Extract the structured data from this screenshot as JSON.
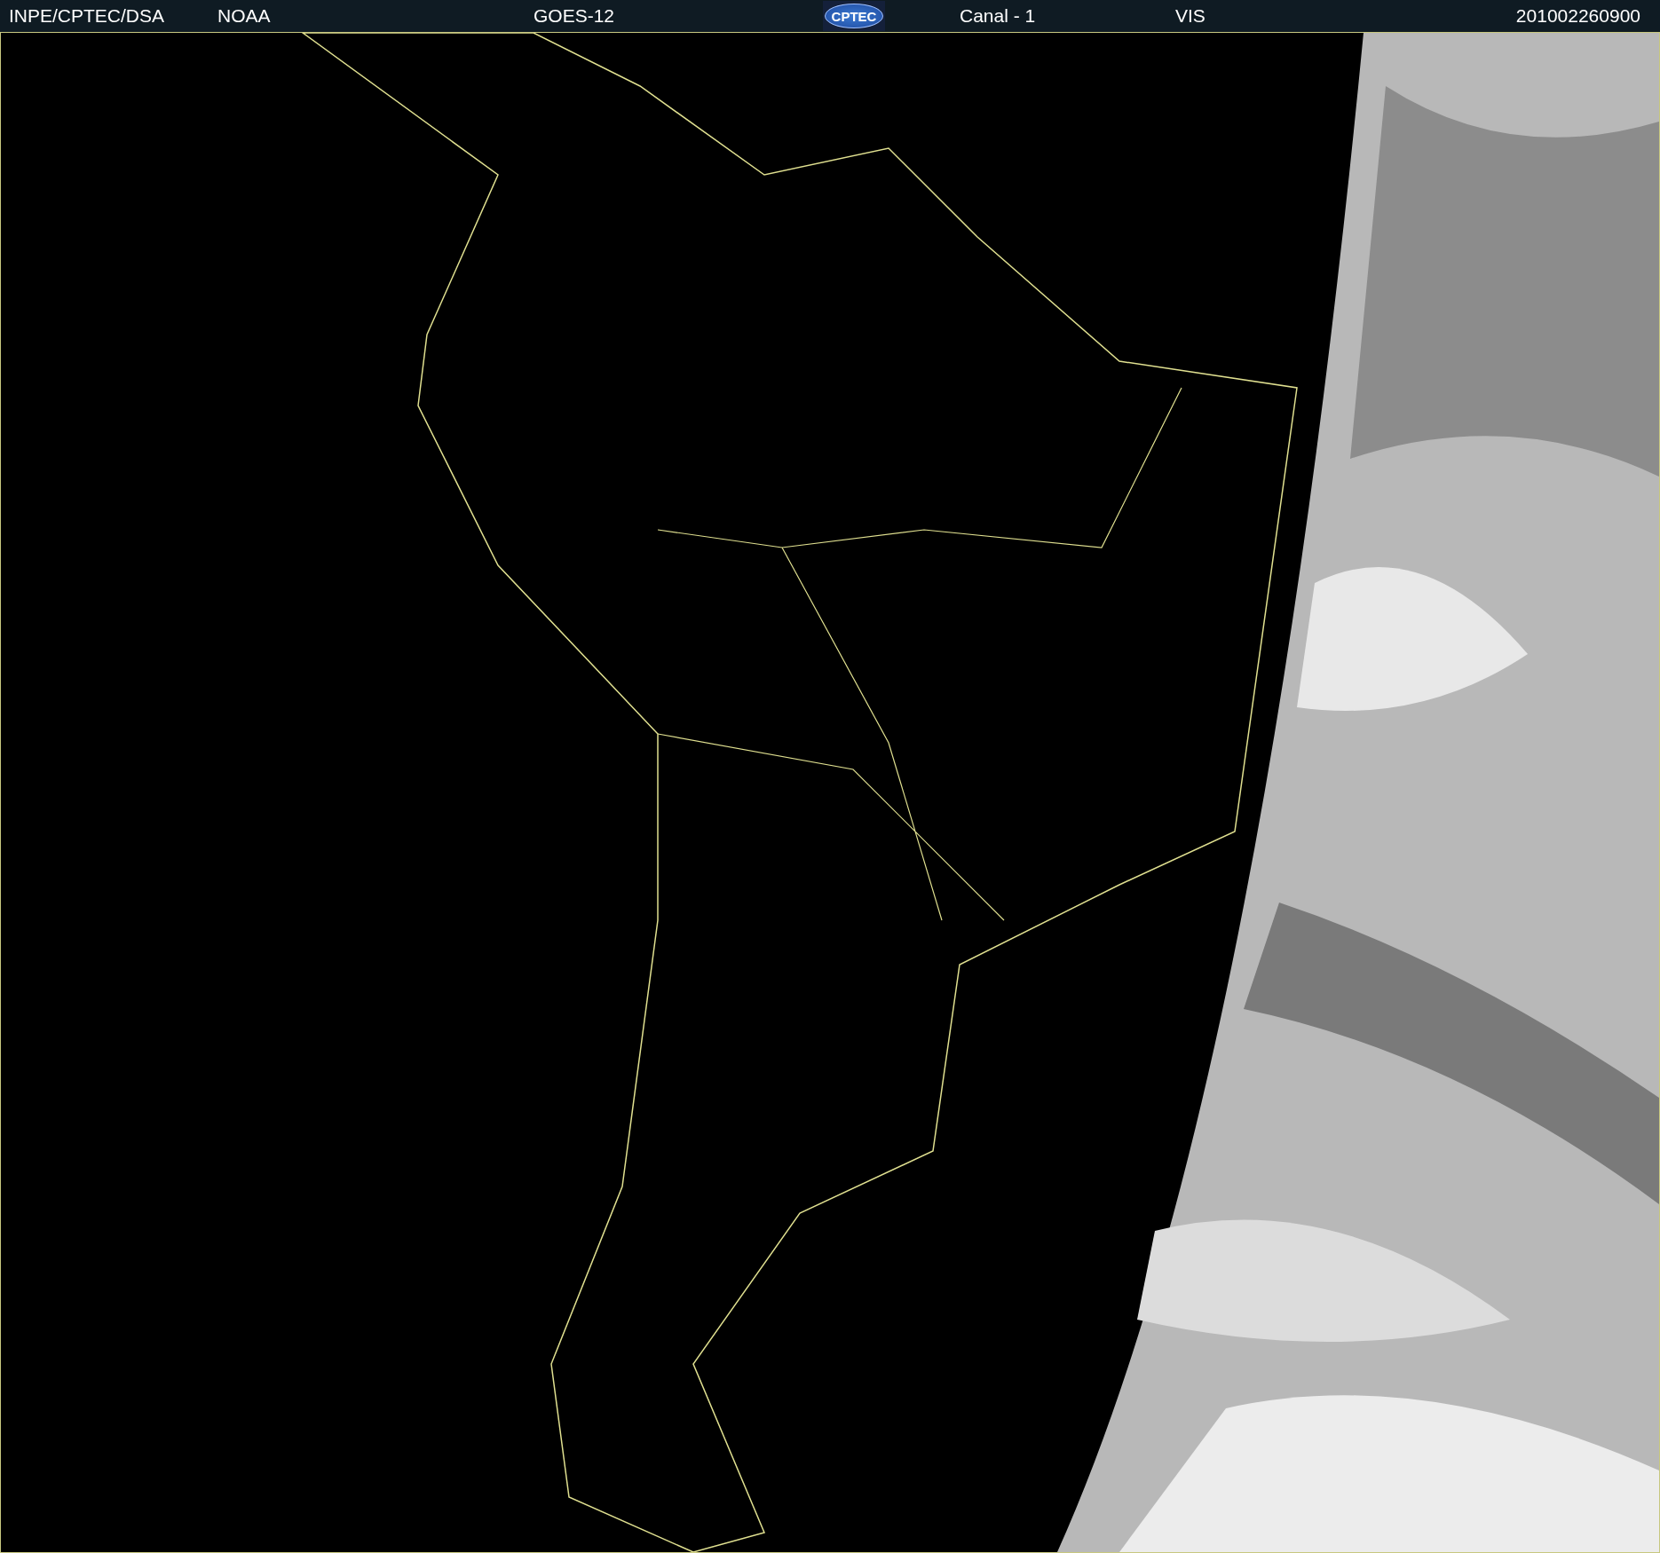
{
  "header": {
    "items": [
      {
        "kind": "text",
        "label": "INPE/CPTEC/DSA"
      },
      {
        "kind": "text",
        "label": "NOAA"
      },
      {
        "kind": "text",
        "label": "GOES-12"
      },
      {
        "kind": "logo",
        "label": "CPTEC"
      },
      {
        "kind": "text",
        "label": "Canal - 1"
      },
      {
        "kind": "text",
        "label": "VIS"
      },
      {
        "kind": "text",
        "label": "201002260900"
      }
    ]
  }
}
